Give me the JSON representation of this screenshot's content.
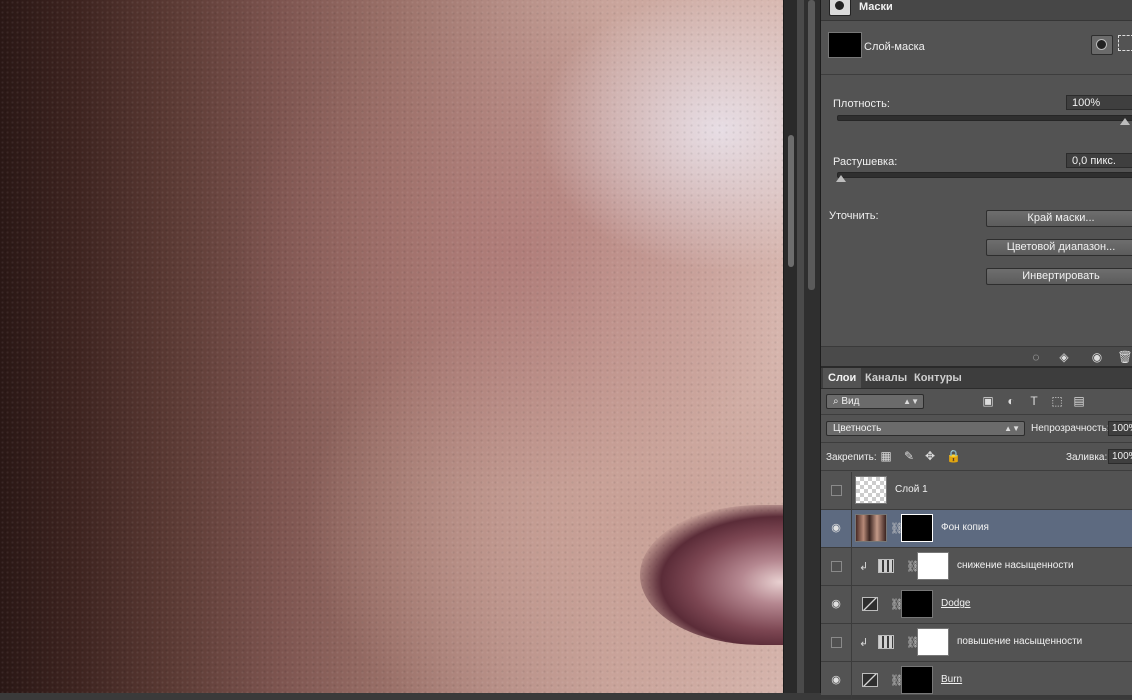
{
  "properties": {
    "title": "Маски",
    "mask_name": "Слой-маска",
    "density_label": "Плотность:",
    "density_value": "100%",
    "density_level_pct": 100,
    "feather_label": "Растушевка:",
    "feather_value": "0,0 пикс.",
    "feather_level_pct": 0,
    "refine_label": "Уточнить:",
    "buttons": {
      "mask_edge": "Край маски...",
      "color_range": "Цветовой диапазон...",
      "invert": "Инвертировать"
    },
    "footer_icons": [
      "load-selection-icon",
      "apply-mask-icon",
      "eye-icon",
      "trash-icon"
    ]
  },
  "layers_panel": {
    "tabs": [
      "Слои",
      "Каналы",
      "Контуры"
    ],
    "active_tab": "Слои",
    "filter_label": "Вид",
    "filter_icons": [
      "image-filter-icon",
      "adjustment-filter-icon",
      "type-filter-icon",
      "shape-filter-icon",
      "smart-object-filter-icon"
    ],
    "blend_mode": "Цветность",
    "opacity_label": "Непрозрачность:",
    "opacity_value": "100%",
    "lock_label": "Закрепить:",
    "lock_icons": [
      "lock-transparent-icon",
      "lock-brush-icon",
      "lock-move-icon",
      "lock-all-icon"
    ],
    "fill_label": "Заливка:",
    "fill_value": "100%",
    "layers": [
      {
        "name": "Слой 1",
        "visible": false,
        "selected": false
      },
      {
        "name": "Фон копия",
        "visible": true,
        "selected": true
      },
      {
        "name": "снижение насыщенности",
        "visible": false,
        "selected": false
      },
      {
        "name": "Dodge",
        "visible": true,
        "selected": false
      },
      {
        "name": "повышение насыщенности",
        "visible": false,
        "selected": false
      },
      {
        "name": "Burn",
        "visible": true,
        "selected": false
      }
    ]
  },
  "colors": {
    "panel_bg": "#535353",
    "selected_layer": "#5d6a80",
    "dark_bg": "#3a3a3a"
  }
}
